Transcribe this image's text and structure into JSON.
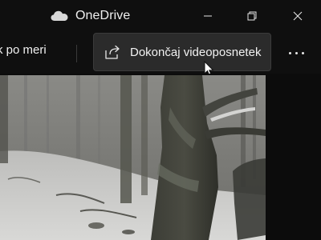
{
  "app": {
    "title": "OneDrive",
    "icon": "cloud-icon"
  },
  "window_controls": {
    "minimize_icon": "minimize-icon",
    "maximize_icon": "restore-icon",
    "close_icon": "close-icon"
  },
  "toolbar": {
    "left_button_label": "k po meri",
    "finish_button": {
      "label": "Dokončaj videoposnetek",
      "icon": "share-icon"
    },
    "more_icon": "more-icon"
  },
  "video": {
    "description_icon": "video-preview"
  },
  "colors": {
    "titlebar_bg": "#0f0f0f",
    "button_bg": "#2b2b2b",
    "text": "#f2f2f2"
  }
}
